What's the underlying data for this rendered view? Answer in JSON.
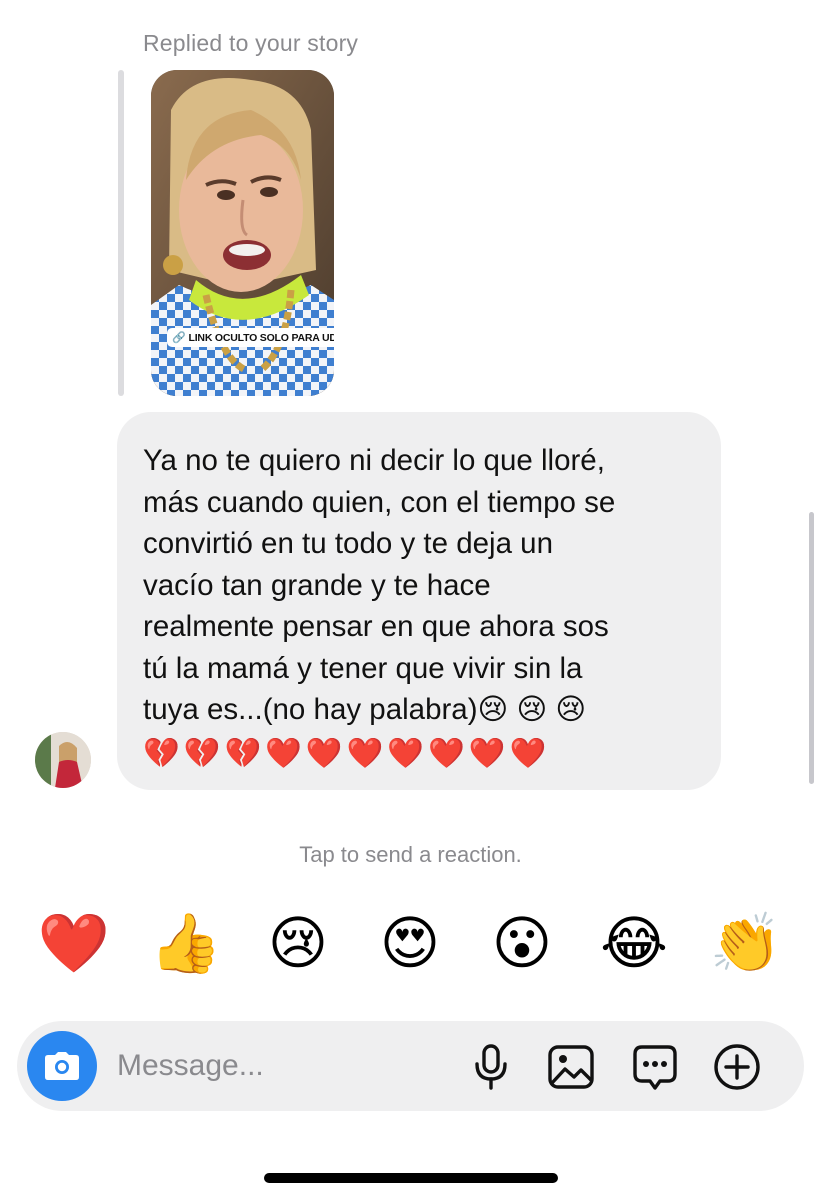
{
  "story": {
    "caption": "Replied to your story",
    "sticker_text": "LINK OCULTO SOLO PARA UDS"
  },
  "message": {
    "text": "Ya no te quiero ni decir lo que lloré,\nmás cuando quien, con el tiempo se\nconvirtió en tu todo y te deja un\nvacío tan grande y te hace\nrealmente pensar en que ahora sos\ntú la mamá y tener que vivir sin la\ntuya es...(no hay palabra)😢 😢 😢",
    "emoji_line": "💔💔💔❤️❤️❤️❤️❤️❤️❤️"
  },
  "reactions": {
    "hint": "Tap to send a reaction.",
    "items": [
      {
        "emoji": "❤️",
        "name": "heart"
      },
      {
        "emoji": "👍",
        "name": "thumbs-up"
      },
      {
        "emoji": "😢",
        "name": "crying"
      },
      {
        "emoji": "😍",
        "name": "heart-eyes"
      },
      {
        "emoji": "😮",
        "name": "surprised"
      },
      {
        "emoji": "😂",
        "name": "laughing"
      },
      {
        "emoji": "👏",
        "name": "clapping"
      }
    ]
  },
  "composer": {
    "placeholder": "Message...",
    "icons": [
      "camera-icon",
      "microphone-icon",
      "gallery-icon",
      "sticker-icon",
      "add-icon"
    ]
  },
  "colors": {
    "accent": "#2a87f0",
    "bubble": "#efeff0",
    "secondary_text": "#8a8a8e"
  }
}
